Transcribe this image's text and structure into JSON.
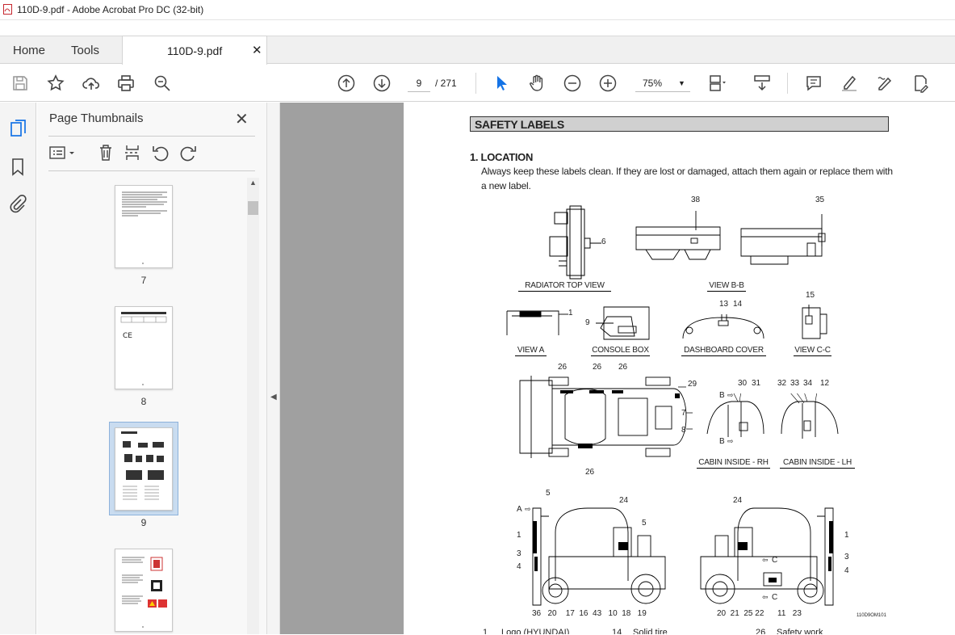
{
  "window": {
    "title": "110D-9.pdf - Adobe Acrobat Pro DC (32-bit)"
  },
  "tabs": {
    "home": "Home",
    "tools": "Tools",
    "doc": "110D-9.pdf"
  },
  "toolbar": {
    "page_current": "9",
    "page_total": "/ 271",
    "zoom": "75%"
  },
  "panel": {
    "title": "Page Thumbnails",
    "thumbnails": [
      {
        "page": "7"
      },
      {
        "page": "8"
      },
      {
        "page": "9",
        "selected": true
      },
      {
        "page": ""
      }
    ]
  },
  "document": {
    "heading": "SAFETY LABELS",
    "section": "1. LOCATION",
    "paragraph": "Always keep these labels clean.  If they are lost or damaged, attach them again or replace them with a new label.",
    "captions": {
      "radiator": "RADIATOR TOP VIEW",
      "view_bb": "VIEW B-B",
      "view_a": "VIEW A",
      "console": "CONSOLE BOX",
      "dashboard": "DASHBOARD COVER",
      "view_cc": "VIEW C-C",
      "cabin_rh": "CABIN INSIDE - RH",
      "cabin_lh": "CABIN INSIDE - LH"
    },
    "callouts": {
      "n38": "38",
      "n35": "35",
      "n6": "6",
      "n1a": "1",
      "n9": "9",
      "n13": "13",
      "n14": "14",
      "n15": "15",
      "t26a": "26",
      "t26b": "26",
      "t26c": "26",
      "n29": "29",
      "n7": "7",
      "n8": "8",
      "b26": "26",
      "n30": "30",
      "n31": "31",
      "n32": "32",
      "n33": "33",
      "n34": "34",
      "n12": "12",
      "bb1": "B",
      "bb2": "B",
      "l5": "5",
      "l24": "24",
      "l5b": "5",
      "la": "A",
      "l1": "1",
      "l3": "3",
      "l4": "4",
      "r24": "24",
      "r1": "1",
      "r3": "3",
      "r4": "4",
      "rc1": "C",
      "rc2": "C",
      "bottom_left": "36   20    17  16  43   10  18   19",
      "bottom_right": "20  21  25 22      11   23",
      "ref": "110D9OM101"
    },
    "legend": [
      {
        "num": "1",
        "text": "Logo (HYUNDAI)"
      },
      {
        "num": "14",
        "text": "Solid tire"
      },
      {
        "num": "26",
        "text": "Safety work"
      }
    ]
  }
}
